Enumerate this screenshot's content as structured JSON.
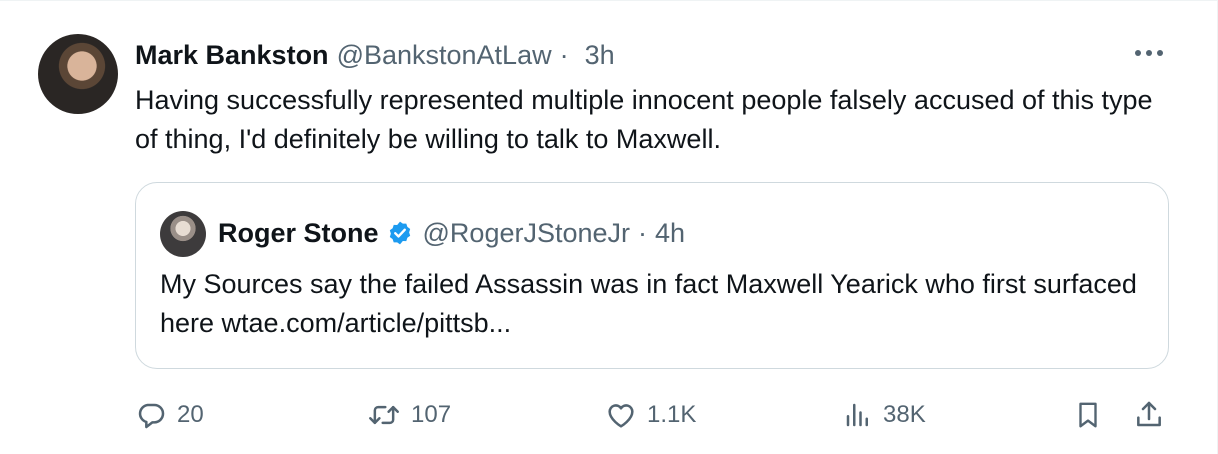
{
  "tweet": {
    "author_name": "Mark Bankston",
    "handle": "@BankstonAtLaw",
    "separator": "·",
    "time": "3h",
    "text": "Having successfully represented multiple innocent people falsely accused of this type of thing, I'd definitely be willing to talk to Maxwell."
  },
  "quoted_tweet": {
    "author_name": "Roger Stone",
    "verified": true,
    "handle": "@RogerJStoneJr",
    "separator": "·",
    "time": "4h",
    "text": "My Sources say the failed Assassin was in fact Maxwell Yearick who first surfaced here  wtae.com/article/pittsb..."
  },
  "actions": {
    "replies": "20",
    "reposts": "107",
    "likes": "1.1K",
    "views": "38K"
  },
  "colors": {
    "text": "#0f1419",
    "secondary": "#536471",
    "border": "#cfd9de",
    "verified": "#1d9bf0"
  },
  "icons": [
    "more-icon",
    "verified-badge-icon",
    "reply-icon",
    "repost-icon",
    "like-icon",
    "views-icon",
    "bookmark-icon",
    "share-icon"
  ]
}
